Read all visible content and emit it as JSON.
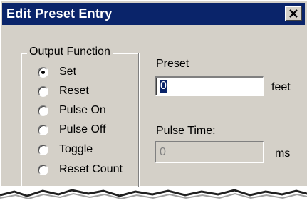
{
  "window": {
    "title": "Edit Preset Entry",
    "close_icon": "close-icon"
  },
  "output_function": {
    "legend": "Output Function",
    "selected": "Set",
    "options": [
      {
        "label": "Set",
        "checked": true
      },
      {
        "label": "Reset",
        "checked": false
      },
      {
        "label": "Pulse On",
        "checked": false
      },
      {
        "label": "Pulse Off",
        "checked": false
      },
      {
        "label": "Toggle",
        "checked": false
      },
      {
        "label": "Reset Count",
        "checked": false
      }
    ]
  },
  "preset": {
    "label": "Preset",
    "value": "0",
    "unit": "feet"
  },
  "pulse_time": {
    "label": "Pulse Time:",
    "value": "0",
    "unit": "ms",
    "enabled": false
  },
  "colors": {
    "titlebar": "#0a246a",
    "dialog_face": "#d4d0c8",
    "selection": "#0a246a",
    "disabled_text": "#808080"
  }
}
